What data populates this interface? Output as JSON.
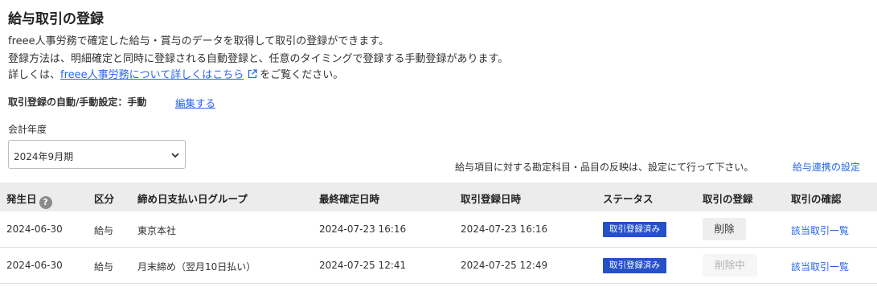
{
  "page": {
    "title": "給与取引の登録",
    "desc_line1": "freee人事労務で確定した給与・賞与のデータを取得して取引の登録ができます。",
    "desc_line2": "登録方法は、明細確定と同時に登録される自動登録と、任意のタイミングで登録する手動登録があります。",
    "desc_line3_prefix": "詳しくは、",
    "desc_line3_link": "freee人事労務について詳しくはこちら",
    "desc_line3_suffix": "をご覧ください。"
  },
  "setting": {
    "label": "取引登録の自動/手動設定：手動",
    "edit_label": "編集する"
  },
  "fiscal_year": {
    "label": "会計年度",
    "selected": "2024年9月期"
  },
  "note": {
    "text": "給与項目に対する勘定科目・品目の反映は、設定にて行って下さい。",
    "link": "給与連携の設定"
  },
  "table": {
    "headers": [
      "発生日",
      "区分",
      "締め日支払い日グループ",
      "最終確定日時",
      "取引登録日時",
      "ステータス",
      "取引の登録",
      "取引の確認"
    ],
    "rows": [
      {
        "date": "2024-06-30",
        "category": "給与",
        "group": "東京本社",
        "final_confirmed": "2024-07-23 16:16",
        "registered": "2024-07-23 16:16",
        "status": "取引登録済み",
        "action": "削除",
        "action_disabled": false,
        "confirm_link": "該当取引一覧"
      },
      {
        "date": "2024-06-30",
        "category": "給与",
        "group": "月末締め（翌月10日払い）",
        "final_confirmed": "2024-07-25 12:41",
        "registered": "2024-07-25 12:49",
        "status": "取引登録済み",
        "action": "削除中",
        "action_disabled": true,
        "confirm_link": "該当取引一覧"
      }
    ]
  },
  "colors": {
    "link": "#2864f0",
    "status_badge": "#2450c8",
    "header_bg": "#ececec"
  }
}
